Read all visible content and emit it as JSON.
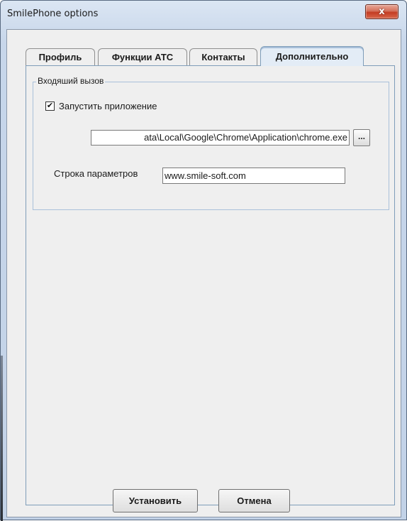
{
  "window": {
    "title": "SmilePhone options",
    "close_label": "x"
  },
  "tabs": [
    {
      "label": "Профиль",
      "active": false
    },
    {
      "label": "Функции АТС",
      "active": false
    },
    {
      "label": "Контакты",
      "active": false
    },
    {
      "label": "Дополнительно",
      "active": true
    }
  ],
  "incoming_call": {
    "group_title": "Входяший вызов",
    "launch_app": {
      "label": "Запустить приложение",
      "checked": true,
      "check_glyph": "✔"
    },
    "app_path": "ata\\Local\\Google\\Chrome\\Application\\chrome.exe",
    "browse_label": "...",
    "params_label": "Строка параметров",
    "params_value": "www.smile-soft.com"
  },
  "buttons": {
    "install_label": "Установить",
    "cancel_label": "Отмена"
  },
  "colors": {
    "close_button": "#c43c22",
    "active_tab_border": "#7f9db9"
  }
}
